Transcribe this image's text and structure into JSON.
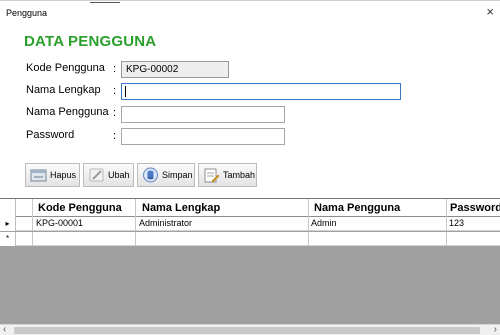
{
  "window": {
    "title": "Pengguna",
    "close_glyph": "×"
  },
  "heading": "DATA PENGGUNA",
  "form": {
    "colon": ":",
    "kode_label": "Kode Pengguna",
    "kode_value": "KPG-00002",
    "nama_lengkap_label": "Nama Lengkap",
    "nama_lengkap_value": "",
    "nama_pengguna_label": "Nama Pengguna",
    "nama_pengguna_value": "",
    "password_label": "Password",
    "password_value": ""
  },
  "toolbar": {
    "hapus_label": "Hapus",
    "ubah_label": "Ubah",
    "simpan_label": "Simpan",
    "tambah_label": "Tambah"
  },
  "grid": {
    "columns": [
      "Kode Pengguna",
      "Nama Lengkap",
      "Nama Pengguna",
      "Password"
    ],
    "rows": [
      {
        "indicator": "▸",
        "cells": [
          "KPG-00001",
          "Administrator",
          "Admin",
          "123"
        ]
      },
      {
        "indicator": "*",
        "cells": [
          "",
          "",
          "",
          ""
        ]
      }
    ]
  },
  "scrollbar": {
    "left_glyph": "‹",
    "right_glyph": "›"
  },
  "colors": {
    "heading": "#2ca02c",
    "focus_border": "#3a78c9",
    "grid_empty": "#a0a0a0"
  }
}
